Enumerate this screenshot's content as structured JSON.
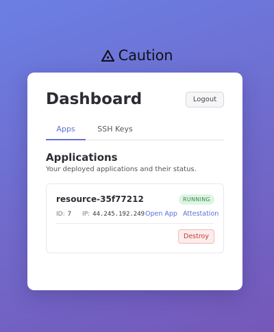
{
  "brand": {
    "name": "Caution",
    "logo_icon": "triangle-dots-logo-icon"
  },
  "page": {
    "title": "Dashboard"
  },
  "header": {
    "logout_label": "Logout"
  },
  "tabs": [
    {
      "label": "Apps",
      "active": true
    },
    {
      "label": "SSH Keys",
      "active": false
    }
  ],
  "section": {
    "title": "Applications",
    "subtitle": "Your deployed applications and their status."
  },
  "apps": [
    {
      "name": "resource-35f77212",
      "status": "RUNNING",
      "id_label": "ID:",
      "id_value": "7",
      "ip_label": "IP:",
      "ip_value": "44.245.192.249",
      "open_label": "Open App",
      "attestation_label": "Attestation",
      "destroy_label": "Destroy"
    }
  ],
  "colors": {
    "accent": "#5b6fd6",
    "running_bg": "#def4e3",
    "running_text": "#2e8a47",
    "danger": "#c23b3b"
  }
}
